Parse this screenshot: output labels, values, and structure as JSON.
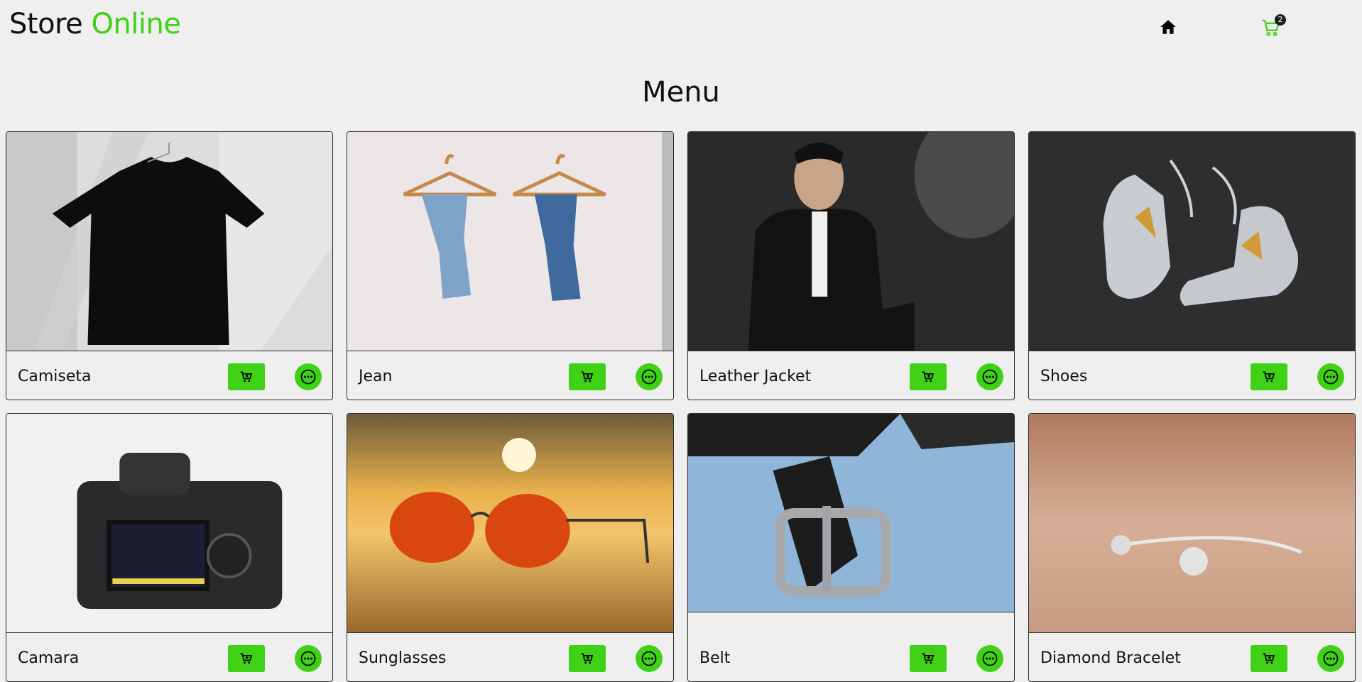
{
  "header": {
    "logo_main": "Store ",
    "logo_accent": "Online",
    "home_icon": "home-icon",
    "cart_icon": "cart-icon",
    "cart_count": "2"
  },
  "page_title": "Menu",
  "colors": {
    "accent": "#3fd116",
    "background": "#efefef",
    "border": "#2b2b2b"
  },
  "products": [
    {
      "name": "Camiseta",
      "image": "black t-shirt on hanger"
    },
    {
      "name": "Jean",
      "image": "two jeans on hangers"
    },
    {
      "name": "Leather Jacket",
      "image": "man in leather jacket"
    },
    {
      "name": "Shoes",
      "image": "grey sneakers"
    },
    {
      "name": "Camara",
      "image": "camera back screen"
    },
    {
      "name": "Sunglasses",
      "image": "aviator sunglasses at sunset"
    },
    {
      "name": "Belt",
      "image": "leather belt buckle on denim"
    },
    {
      "name": "Diamond Bracelet",
      "image": "silver bracelet"
    }
  ],
  "product_actions": {
    "add_icon": "add-to-cart-icon",
    "more_icon": "more-options-icon"
  }
}
